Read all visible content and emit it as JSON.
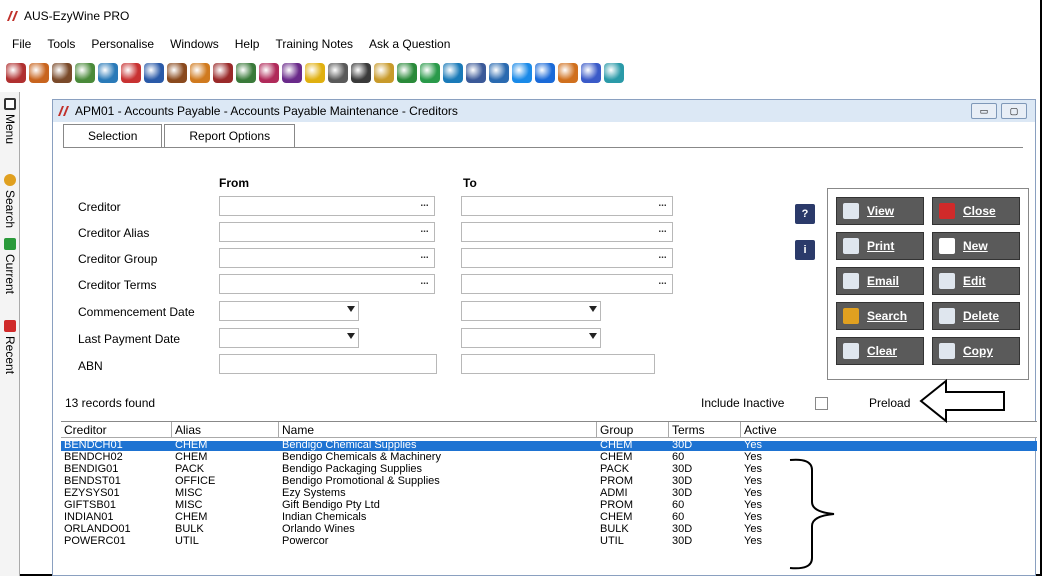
{
  "app": {
    "title": "AUS-EzyWine PRO"
  },
  "menu": [
    "File",
    "Tools",
    "Personalise",
    "Windows",
    "Help",
    "Training Notes",
    "Ask a Question"
  ],
  "toolbar": {
    "icons": [
      {
        "name": "wine-glass-icon",
        "color": "#b03030"
      },
      {
        "name": "palette-icon",
        "color": "#c8641e"
      },
      {
        "name": "building-icon",
        "color": "#7a4a2a"
      },
      {
        "name": "tag-icon",
        "color": "#4a8a3a"
      },
      {
        "name": "grid-icon",
        "color": "#2a7ab8"
      },
      {
        "name": "people-icon",
        "color": "#c83232"
      },
      {
        "name": "pen-icon",
        "color": "#2a5aa8"
      },
      {
        "name": "barrel-icon",
        "color": "#8a4a1e"
      },
      {
        "name": "box-icon",
        "color": "#d07a1e"
      },
      {
        "name": "glass-icon",
        "color": "#9a2a2a"
      },
      {
        "name": "truck-icon",
        "color": "#3a7a3a"
      },
      {
        "name": "chart-icon",
        "color": "#b02a5a"
      },
      {
        "name": "grapes-icon",
        "color": "#6a2a8a"
      },
      {
        "name": "star-icon",
        "color": "#e0b010"
      },
      {
        "name": "gear-icon",
        "color": "#5a5a5a"
      },
      {
        "name": "document-icon",
        "color": "#3a3a3a"
      },
      {
        "name": "cube-icon",
        "color": "#c89a2a"
      },
      {
        "name": "plant-icon",
        "color": "#2a8a3a"
      },
      {
        "name": "dollar-icon",
        "color": "#2a9a4a"
      },
      {
        "name": "database-icon",
        "color": "#1a7ab8"
      },
      {
        "name": "facebook-icon",
        "color": "#3b5998"
      },
      {
        "name": "linkedin-icon",
        "color": "#2a6ab0"
      },
      {
        "name": "globe-icon",
        "color": "#1a8ae8"
      },
      {
        "name": "info-icon",
        "color": "#1a6ad8"
      },
      {
        "name": "bottle-icon",
        "color": "#d0701e"
      },
      {
        "name": "help-icon",
        "color": "#3a5ac8"
      },
      {
        "name": "web-icon",
        "color": "#2a9aa8"
      }
    ]
  },
  "sidebar": [
    {
      "label": "Menu",
      "color": "#333333"
    },
    {
      "label": "Search",
      "color": "#e0a020"
    },
    {
      "label": "Current",
      "color": "#2a9a3a"
    },
    {
      "label": "Recent",
      "color": "#d02a2a"
    }
  ],
  "window": {
    "title": "APM01 - Accounts Payable - Accounts Payable Maintenance - Creditors",
    "min": "▭",
    "max": "▢"
  },
  "tabs": [
    "Selection",
    "Report Options"
  ],
  "form": {
    "from_label": "From",
    "to_label": "To",
    "fields": [
      "Creditor",
      "Creditor Alias",
      "Creditor Group",
      "Creditor Terms",
      "Commencement Date",
      "Last Payment Date",
      "ABN"
    ]
  },
  "small_buttons": {
    "help": "?",
    "info": "i"
  },
  "buttons": {
    "view": "View",
    "close": "Close",
    "print": "Print",
    "new": "New",
    "email": "Email",
    "edit": "Edit",
    "search": "Search",
    "delete": "Delete",
    "clear": "Clear",
    "copy": "Copy"
  },
  "status": {
    "records": "13 records found",
    "include_inactive": "Include Inactive",
    "preload": "Preload",
    "include_inactive_checked": false,
    "preload_checked": true
  },
  "grid": {
    "columns": [
      "Creditor",
      "Alias",
      "Name",
      "Group",
      "Terms",
      "Active"
    ],
    "rows": [
      [
        "BENDCH01",
        "CHEM",
        "Bendigo Chemical Supplies",
        "CHEM",
        "30D",
        "Yes"
      ],
      [
        "BENDCH02",
        "CHEM",
        "Bendigo Chemicals & Machinery",
        "CHEM",
        "60",
        "Yes"
      ],
      [
        "BENDIG01",
        "PACK",
        "Bendigo Packaging Supplies",
        "PACK",
        "30D",
        "Yes"
      ],
      [
        "BENDST01",
        "OFFICE",
        "Bendigo Promotional & Supplies",
        "PROM",
        "30D",
        "Yes"
      ],
      [
        "EZYSYS01",
        "MISC",
        "Ezy Systems",
        "ADMI",
        "30D",
        "Yes"
      ],
      [
        "GIFTSB01",
        "MISC",
        "Gift Bendigo Pty Ltd",
        "PROM",
        "60",
        "Yes"
      ],
      [
        "INDIAN01",
        "CHEM",
        "Indian Chemicals",
        "CHEM",
        "60",
        "Yes"
      ],
      [
        "ORLANDO01",
        "BULK",
        "Orlando Wines",
        "BULK",
        "30D",
        "Yes"
      ],
      [
        "POWERC01",
        "UTIL",
        "Powercor",
        "UTIL",
        "30D",
        "Yes"
      ]
    ]
  }
}
